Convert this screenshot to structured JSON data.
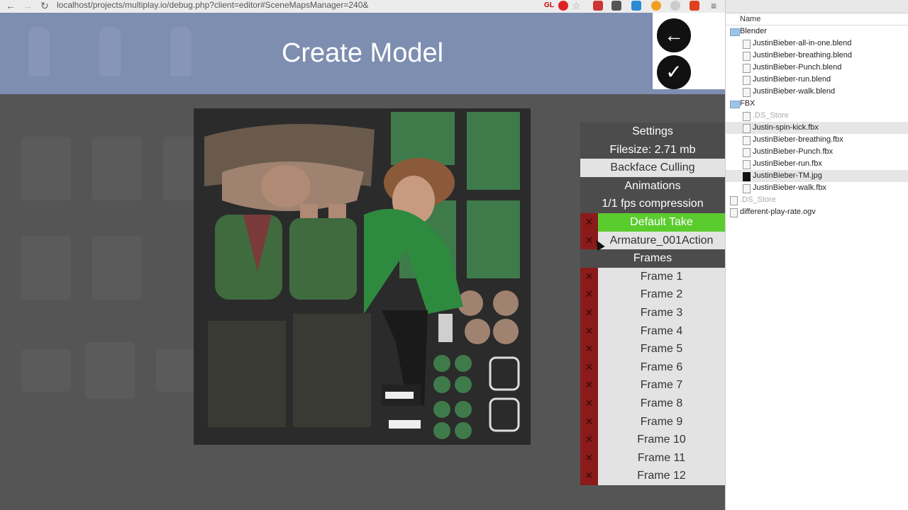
{
  "browser": {
    "url": "localhost/projects/multiplay.io/debug.php?client=editor#SceneMapsManager=240&",
    "ext_gl": "GL"
  },
  "header": {
    "title": "Create Model"
  },
  "panel": {
    "settings": "Settings",
    "filesize": "Filesize: 2.71 mb",
    "backface": "Backface Culling",
    "animations": "Animations",
    "compression": "1/1 fps compression",
    "takes": [
      "Default Take",
      "Armature_001Action"
    ],
    "frames_label": "Frames",
    "frames": [
      "Frame 1",
      "Frame 2",
      "Frame 3",
      "Frame 4",
      "Frame 5",
      "Frame 6",
      "Frame 7",
      "Frame 8",
      "Frame 9",
      "Frame 10",
      "Frame 11",
      "Frame 12"
    ]
  },
  "finder": {
    "column_header": "Name",
    "items": [
      {
        "name": "Blender",
        "type": "folder",
        "indent": 0
      },
      {
        "name": "JustinBieber-all-in-one.blend",
        "type": "file",
        "indent": 1
      },
      {
        "name": "JustinBieber-breathing.blend",
        "type": "file",
        "indent": 1
      },
      {
        "name": "JustinBieber-Punch.blend",
        "type": "file",
        "indent": 1
      },
      {
        "name": "JustinBieber-run.blend",
        "type": "file",
        "indent": 1
      },
      {
        "name": "JustinBieber-walk.blend",
        "type": "file",
        "indent": 1
      },
      {
        "name": "FBX",
        "type": "folder",
        "indent": 0
      },
      {
        "name": ".DS_Store",
        "type": "hidden",
        "indent": 1
      },
      {
        "name": "Justin-spin-kick.fbx",
        "type": "file",
        "indent": 1,
        "selected": true
      },
      {
        "name": "JustinBieber-breathing.fbx",
        "type": "file",
        "indent": 1
      },
      {
        "name": "JustinBieber-Punch.fbx",
        "type": "file",
        "indent": 1
      },
      {
        "name": "JustinBieber-run.fbx",
        "type": "file",
        "indent": 1
      },
      {
        "name": "JustinBieber-TM.jpg",
        "type": "image",
        "indent": 1,
        "selected": true
      },
      {
        "name": "JustinBieber-walk.fbx",
        "type": "file",
        "indent": 1
      },
      {
        "name": ".DS_Store",
        "type": "hidden",
        "indent": 0
      },
      {
        "name": "different-play-rate.ogv",
        "type": "video",
        "indent": 0
      }
    ]
  },
  "colors": {
    "header_bg": "#7d8eb0",
    "take_active": "#5bcc2e",
    "delete_red": "#8b1a1a"
  }
}
